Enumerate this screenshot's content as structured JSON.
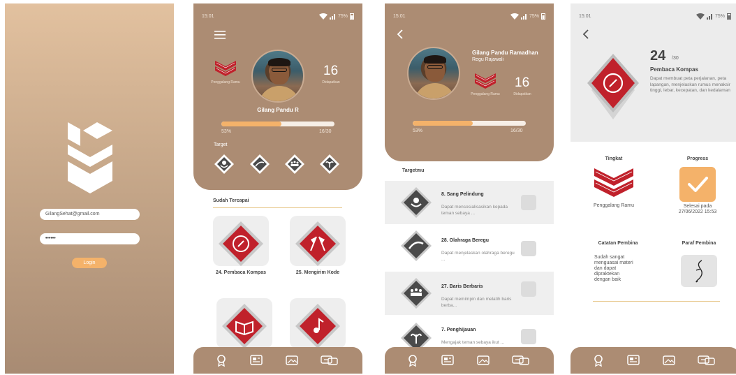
{
  "login": {
    "email_value": "GilangSehat@gmail.com",
    "password_value": "••••••",
    "login_label": "Login"
  },
  "status": {
    "time": "15:01",
    "battery": "75%"
  },
  "home": {
    "rank_label": "Penggalang Ramu",
    "user_name": "Gilang Pandu R",
    "obtained_count": "16",
    "obtained_label": "Didapatkan",
    "progress_percent": "53%",
    "progress_fraction": 0.53,
    "progress_count": "16/30",
    "target_label": "Target",
    "achieved_title": "Sudah Tercapai",
    "cards": [
      {
        "label": "24. Pembaca Kompas",
        "icon": "compass-badge-icon"
      },
      {
        "label": "25. Mengirim Kode",
        "icon": "flags-badge-icon"
      },
      {
        "label": "",
        "icon": "book-badge-icon"
      },
      {
        "label": "",
        "icon": "music-badge-icon"
      }
    ]
  },
  "profile": {
    "full_name": "Gilang Pandu Ramadhan",
    "group": "Regu Rajawali",
    "rank_label": "Penggalang Ramu",
    "obtained_count": "16",
    "obtained_label": "Didapatkan",
    "progress_percent": "53%",
    "progress_fraction": 0.53,
    "progress_count": "16/30",
    "target_title": "Targetmu",
    "targets": [
      {
        "title": "8. Sang Pelindung",
        "desc": "Dapat mensosialisasikan kepada teman sebaya ..."
      },
      {
        "title": "28. Olahraga Beregu",
        "desc": "Dapat menjelaskan olahraga beregu ..."
      },
      {
        "title": "27. Baris Berbaris",
        "desc": "Dapat memimpin dan melatih baris berba..."
      },
      {
        "title": "7. Penghijauan",
        "desc": "Mengajak teman sebaya ikut ..."
      }
    ]
  },
  "detail": {
    "number": "24",
    "of_total": "/30",
    "title": "Pembaca Kompas",
    "description": "Dapat membuat peta perjalanan, peta lapangan, menjelaskan rumus menaksir tinggi, lebar, kecepatan, dan kedalaman",
    "level_header": "Tingkat",
    "level_value": "Penggalang Ramu",
    "progress_header": "Progress",
    "progress_value": "Selesai pada 27/06/2022 15:53",
    "notes_header": "Catatan Pembina",
    "notes_value": "Sudah sangat menguasai materi dan dapat dipraktekan dengan baik",
    "signature_header": "Paraf Pembina"
  },
  "nav": [
    "badge-icon",
    "news-icon",
    "gallery-icon",
    "chat-icon"
  ],
  "colors": {
    "brown": "#ac8c73",
    "accent": "#f4b26a",
    "badge_red": "#c0212b"
  }
}
